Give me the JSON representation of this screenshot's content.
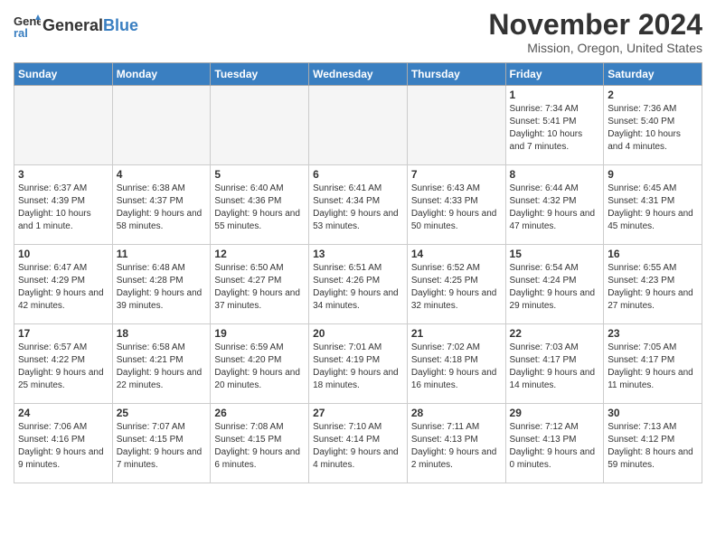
{
  "header": {
    "logo_line1": "General",
    "logo_line2": "Blue",
    "month": "November 2024",
    "location": "Mission, Oregon, United States"
  },
  "weekdays": [
    "Sunday",
    "Monday",
    "Tuesday",
    "Wednesday",
    "Thursday",
    "Friday",
    "Saturday"
  ],
  "weeks": [
    [
      {
        "num": "",
        "info": ""
      },
      {
        "num": "",
        "info": ""
      },
      {
        "num": "",
        "info": ""
      },
      {
        "num": "",
        "info": ""
      },
      {
        "num": "",
        "info": ""
      },
      {
        "num": "1",
        "info": "Sunrise: 7:34 AM\nSunset: 5:41 PM\nDaylight: 10 hours and 7 minutes."
      },
      {
        "num": "2",
        "info": "Sunrise: 7:36 AM\nSunset: 5:40 PM\nDaylight: 10 hours and 4 minutes."
      }
    ],
    [
      {
        "num": "3",
        "info": "Sunrise: 6:37 AM\nSunset: 4:39 PM\nDaylight: 10 hours and 1 minute."
      },
      {
        "num": "4",
        "info": "Sunrise: 6:38 AM\nSunset: 4:37 PM\nDaylight: 9 hours and 58 minutes."
      },
      {
        "num": "5",
        "info": "Sunrise: 6:40 AM\nSunset: 4:36 PM\nDaylight: 9 hours and 55 minutes."
      },
      {
        "num": "6",
        "info": "Sunrise: 6:41 AM\nSunset: 4:34 PM\nDaylight: 9 hours and 53 minutes."
      },
      {
        "num": "7",
        "info": "Sunrise: 6:43 AM\nSunset: 4:33 PM\nDaylight: 9 hours and 50 minutes."
      },
      {
        "num": "8",
        "info": "Sunrise: 6:44 AM\nSunset: 4:32 PM\nDaylight: 9 hours and 47 minutes."
      },
      {
        "num": "9",
        "info": "Sunrise: 6:45 AM\nSunset: 4:31 PM\nDaylight: 9 hours and 45 minutes."
      }
    ],
    [
      {
        "num": "10",
        "info": "Sunrise: 6:47 AM\nSunset: 4:29 PM\nDaylight: 9 hours and 42 minutes."
      },
      {
        "num": "11",
        "info": "Sunrise: 6:48 AM\nSunset: 4:28 PM\nDaylight: 9 hours and 39 minutes."
      },
      {
        "num": "12",
        "info": "Sunrise: 6:50 AM\nSunset: 4:27 PM\nDaylight: 9 hours and 37 minutes."
      },
      {
        "num": "13",
        "info": "Sunrise: 6:51 AM\nSunset: 4:26 PM\nDaylight: 9 hours and 34 minutes."
      },
      {
        "num": "14",
        "info": "Sunrise: 6:52 AM\nSunset: 4:25 PM\nDaylight: 9 hours and 32 minutes."
      },
      {
        "num": "15",
        "info": "Sunrise: 6:54 AM\nSunset: 4:24 PM\nDaylight: 9 hours and 29 minutes."
      },
      {
        "num": "16",
        "info": "Sunrise: 6:55 AM\nSunset: 4:23 PM\nDaylight: 9 hours and 27 minutes."
      }
    ],
    [
      {
        "num": "17",
        "info": "Sunrise: 6:57 AM\nSunset: 4:22 PM\nDaylight: 9 hours and 25 minutes."
      },
      {
        "num": "18",
        "info": "Sunrise: 6:58 AM\nSunset: 4:21 PM\nDaylight: 9 hours and 22 minutes."
      },
      {
        "num": "19",
        "info": "Sunrise: 6:59 AM\nSunset: 4:20 PM\nDaylight: 9 hours and 20 minutes."
      },
      {
        "num": "20",
        "info": "Sunrise: 7:01 AM\nSunset: 4:19 PM\nDaylight: 9 hours and 18 minutes."
      },
      {
        "num": "21",
        "info": "Sunrise: 7:02 AM\nSunset: 4:18 PM\nDaylight: 9 hours and 16 minutes."
      },
      {
        "num": "22",
        "info": "Sunrise: 7:03 AM\nSunset: 4:17 PM\nDaylight: 9 hours and 14 minutes."
      },
      {
        "num": "23",
        "info": "Sunrise: 7:05 AM\nSunset: 4:17 PM\nDaylight: 9 hours and 11 minutes."
      }
    ],
    [
      {
        "num": "24",
        "info": "Sunrise: 7:06 AM\nSunset: 4:16 PM\nDaylight: 9 hours and 9 minutes."
      },
      {
        "num": "25",
        "info": "Sunrise: 7:07 AM\nSunset: 4:15 PM\nDaylight: 9 hours and 7 minutes."
      },
      {
        "num": "26",
        "info": "Sunrise: 7:08 AM\nSunset: 4:15 PM\nDaylight: 9 hours and 6 minutes."
      },
      {
        "num": "27",
        "info": "Sunrise: 7:10 AM\nSunset: 4:14 PM\nDaylight: 9 hours and 4 minutes."
      },
      {
        "num": "28",
        "info": "Sunrise: 7:11 AM\nSunset: 4:13 PM\nDaylight: 9 hours and 2 minutes."
      },
      {
        "num": "29",
        "info": "Sunrise: 7:12 AM\nSunset: 4:13 PM\nDaylight: 9 hours and 0 minutes."
      },
      {
        "num": "30",
        "info": "Sunrise: 7:13 AM\nSunset: 4:12 PM\nDaylight: 8 hours and 59 minutes."
      }
    ]
  ]
}
